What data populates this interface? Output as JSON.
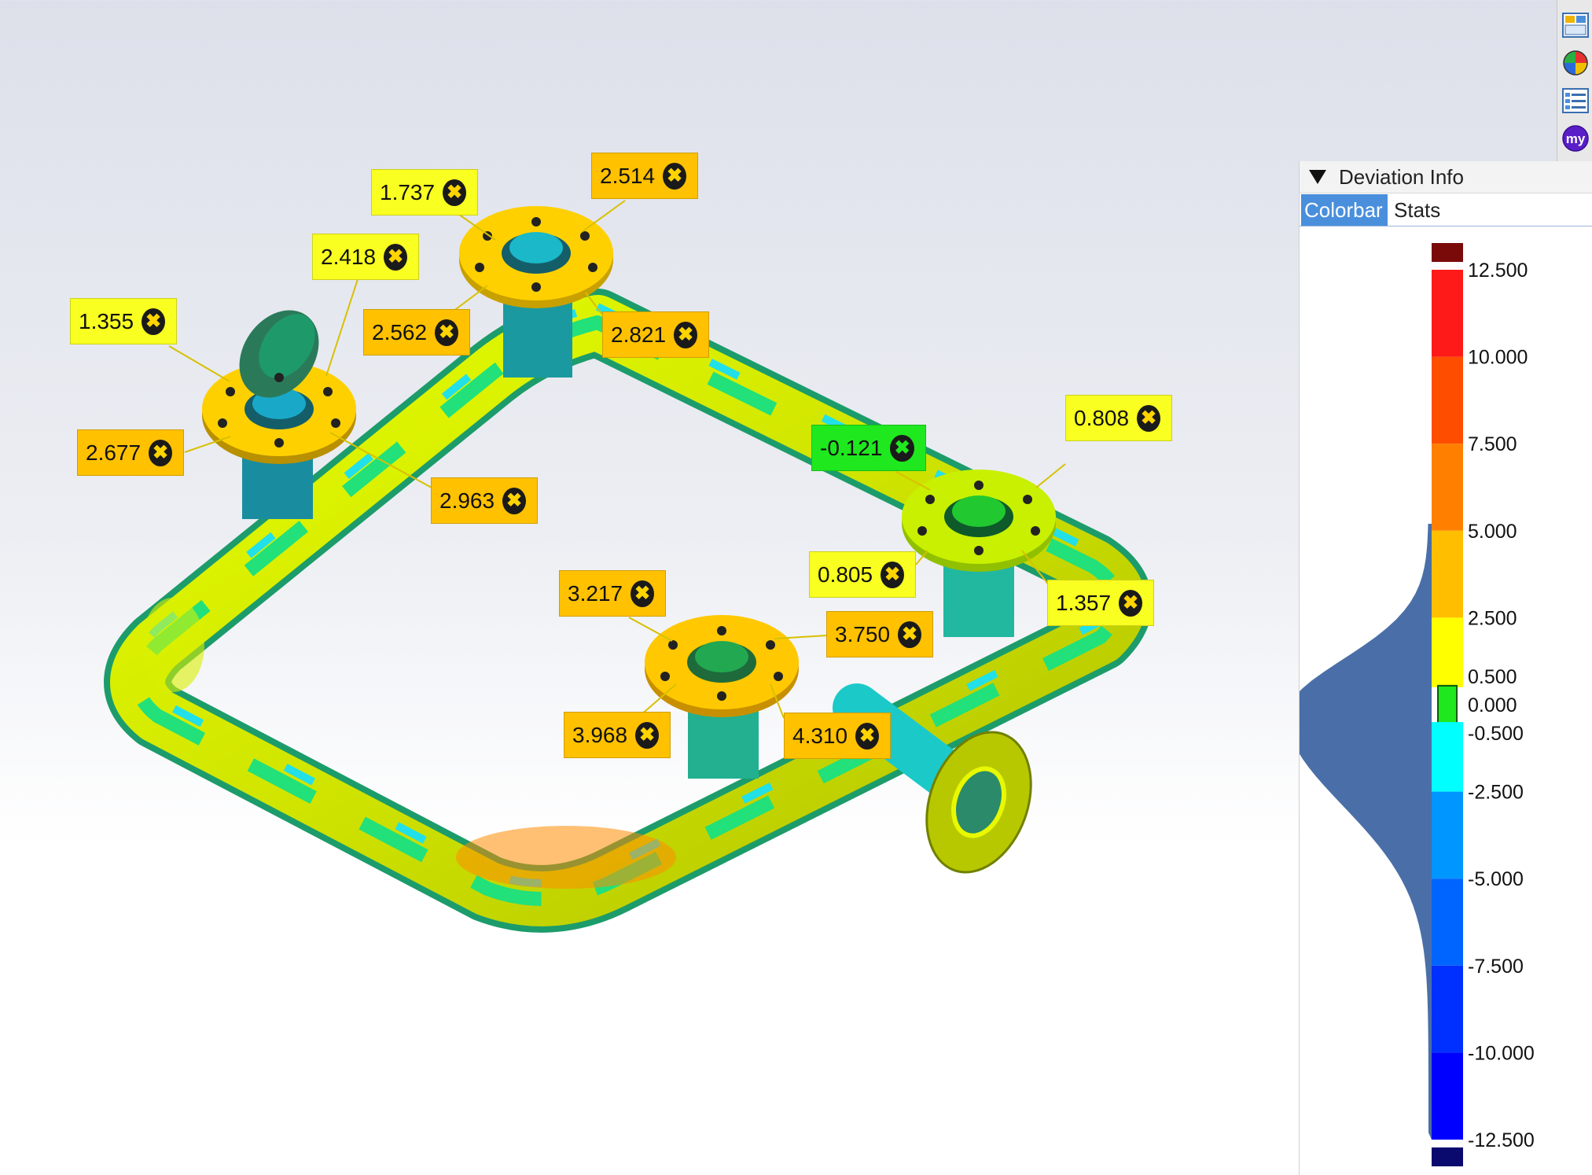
{
  "viewport": {
    "callouts": [
      {
        "value": "1.737",
        "level": "yellow"
      },
      {
        "value": "2.514",
        "level": "orange"
      },
      {
        "value": "2.418",
        "level": "yellow"
      },
      {
        "value": "1.355",
        "level": "yellow"
      },
      {
        "value": "2.562",
        "level": "orange"
      },
      {
        "value": "2.821",
        "level": "orange"
      },
      {
        "value": "2.677",
        "level": "orange"
      },
      {
        "value": "2.963",
        "level": "orange"
      },
      {
        "value": "0.808",
        "level": "yellow"
      },
      {
        "value": "-0.121",
        "level": "green"
      },
      {
        "value": "0.805",
        "level": "yellow"
      },
      {
        "value": "1.357",
        "level": "yellow"
      },
      {
        "value": "3.217",
        "level": "orange"
      },
      {
        "value": "3.750",
        "level": "orange"
      },
      {
        "value": "3.968",
        "level": "orange"
      },
      {
        "value": "4.310",
        "level": "orange"
      }
    ],
    "dismiss_glyph": "✖"
  },
  "toolbar": {
    "buttons": [
      {
        "icon": "layout-icon"
      },
      {
        "icon": "color-wheel-icon"
      },
      {
        "icon": "list-view-icon"
      },
      {
        "icon": "my-icon",
        "label": "my"
      }
    ]
  },
  "panel": {
    "title": "Deviation Info",
    "tabs": [
      {
        "label": "Colorbar",
        "active": true
      },
      {
        "label": "Stats",
        "active": false
      }
    ],
    "colorbar": {
      "labels": [
        "12.500",
        "10.000",
        "7.500",
        "5.000",
        "2.500",
        "0.500",
        "0.000",
        "-0.500",
        "-2.500",
        "-5.000",
        "-7.500",
        "-10.000",
        "-12.500"
      ],
      "tolerance_color": "#1fe81f",
      "segment_colors": [
        "#ff1a1a",
        "#ff4d00",
        "#ff8000",
        "#ffbf00",
        "#ffff00",
        "#00ffff",
        "#00c8ff",
        "#0096ff",
        "#0064ff",
        "#0030ff",
        "#0000ff"
      ],
      "overflow_high_color": "#7a0a0a",
      "overflow_low_color": "#0a0a6e",
      "histogram_color": "#4a6fa8"
    }
  }
}
